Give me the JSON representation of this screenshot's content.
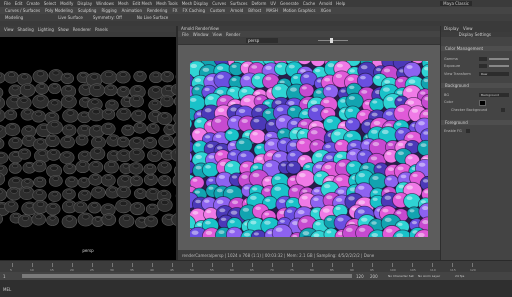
{
  "menu": {
    "items": [
      "File",
      "Edit",
      "Create",
      "Select",
      "Modify",
      "Display",
      "Windows",
      "Mesh",
      "Edit Mesh",
      "Mesh Tools",
      "Mesh Display",
      "Curves",
      "Surfaces",
      "Deform",
      "UV",
      "Generate",
      "Cache",
      "Arnold",
      "Help"
    ],
    "workspace": "Maya Classic"
  },
  "shelf_tabs": [
    "Curves / Surfaces",
    "Poly Modeling",
    "Sculpting",
    "Rigging",
    "Animation",
    "Rendering",
    "FX",
    "FX Caching",
    "Custom",
    "Arnold",
    "Bifrost",
    "MASH",
    "Motion Graphics",
    "XGen"
  ],
  "toolbar_row2": [
    "Modeling",
    "",
    "",
    "",
    "",
    "",
    "",
    "Live Surface",
    "",
    "Symmetry: Off",
    "",
    "",
    "No Live Surface"
  ],
  "viewport": {
    "menu": [
      "View",
      "Shading",
      "Lighting",
      "Show",
      "Renderer",
      "Panels"
    ],
    "camera_label": "persp"
  },
  "render_view": {
    "title": "Arnold RenderView",
    "menu": [
      "File",
      "Window",
      "View",
      "Render"
    ],
    "camera_select": "persp",
    "status": "renderCamera/persp  |  1024 x 768 (1:1)  |  00:03:32  |  Mem: 2.1 GB  |  Sampling: 4/5/2/2/2/2  |  Done"
  },
  "right_panel": {
    "tabs": [
      "Display",
      "View"
    ],
    "header": "Display Settings",
    "sections": {
      "color": "Color Management",
      "background": "Background",
      "foreground": "Foreground"
    },
    "fields": {
      "gamma": "Gamma",
      "exposure": "Exposure",
      "view_transform": "View Transform",
      "view_transform_value": "Raw",
      "bg": "BG",
      "bg_value": "Background",
      "color": "Color",
      "checker": "Checker Background",
      "show_fg": "Enable FG"
    }
  },
  "timeline": {
    "ticks": [
      "5",
      "10",
      "15",
      "20",
      "25",
      "30",
      "35",
      "40",
      "45",
      "50",
      "55",
      "60",
      "65",
      "70",
      "75",
      "80",
      "85",
      "90",
      "95",
      "100",
      "105",
      "110",
      "115",
      "120"
    ],
    "start": "1",
    "end": "120",
    "range_start": "1",
    "range_end": "120",
    "anim_end": "200",
    "char_set": "No Character Set",
    "anim_layer": "No Anim Layer",
    "fps": "24 fps"
  },
  "command_line": {
    "label": "MEL"
  }
}
